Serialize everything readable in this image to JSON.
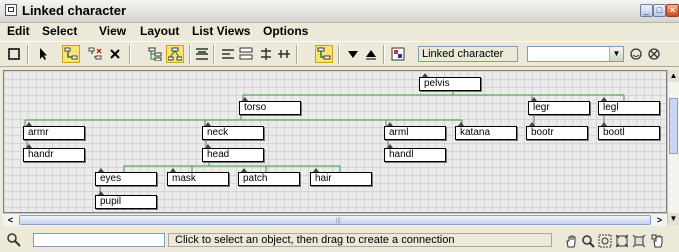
{
  "window": {
    "title": "Linked character"
  },
  "menu": [
    "Edit",
    "Select",
    "View",
    "Layout",
    "List Views",
    "Options"
  ],
  "toolbar": {
    "name_field": "Linked character",
    "combo_value": "",
    "icons": [
      "display-floater-icon",
      "select-icon",
      "connect-icon",
      "unlink-icon",
      "delete-icon",
      "hierarchy-mode-icon",
      "references-mode-icon",
      "arrange-icon",
      "align-left-icon",
      "align-center-icon",
      "align-right-icon",
      "tree-icon",
      "spread-icon",
      "filter-icon",
      "shrink-icon",
      "expand-icon",
      "name-field-icon",
      "rename-icon",
      "reset-icon"
    ]
  },
  "graph": {
    "nodes": [
      {
        "label": "pelvis"
      },
      {
        "label": "torso"
      },
      {
        "label": "legr"
      },
      {
        "label": "legl"
      },
      {
        "label": "armr"
      },
      {
        "label": "neck"
      },
      {
        "label": "arml"
      },
      {
        "label": "katana"
      },
      {
        "label": "bootr"
      },
      {
        "label": "bootl"
      },
      {
        "label": "handr"
      },
      {
        "label": "head"
      },
      {
        "label": "handl"
      },
      {
        "label": "eyes"
      },
      {
        "label": "mask"
      },
      {
        "label": "patch"
      },
      {
        "label": "hair"
      },
      {
        "label": "pupil"
      }
    ]
  },
  "status": {
    "input_value": "",
    "message": "Click to select an object, then drag to create a connection"
  },
  "colors": {
    "link_line": "#3d9a3d",
    "highlight": "#f8e27a"
  }
}
